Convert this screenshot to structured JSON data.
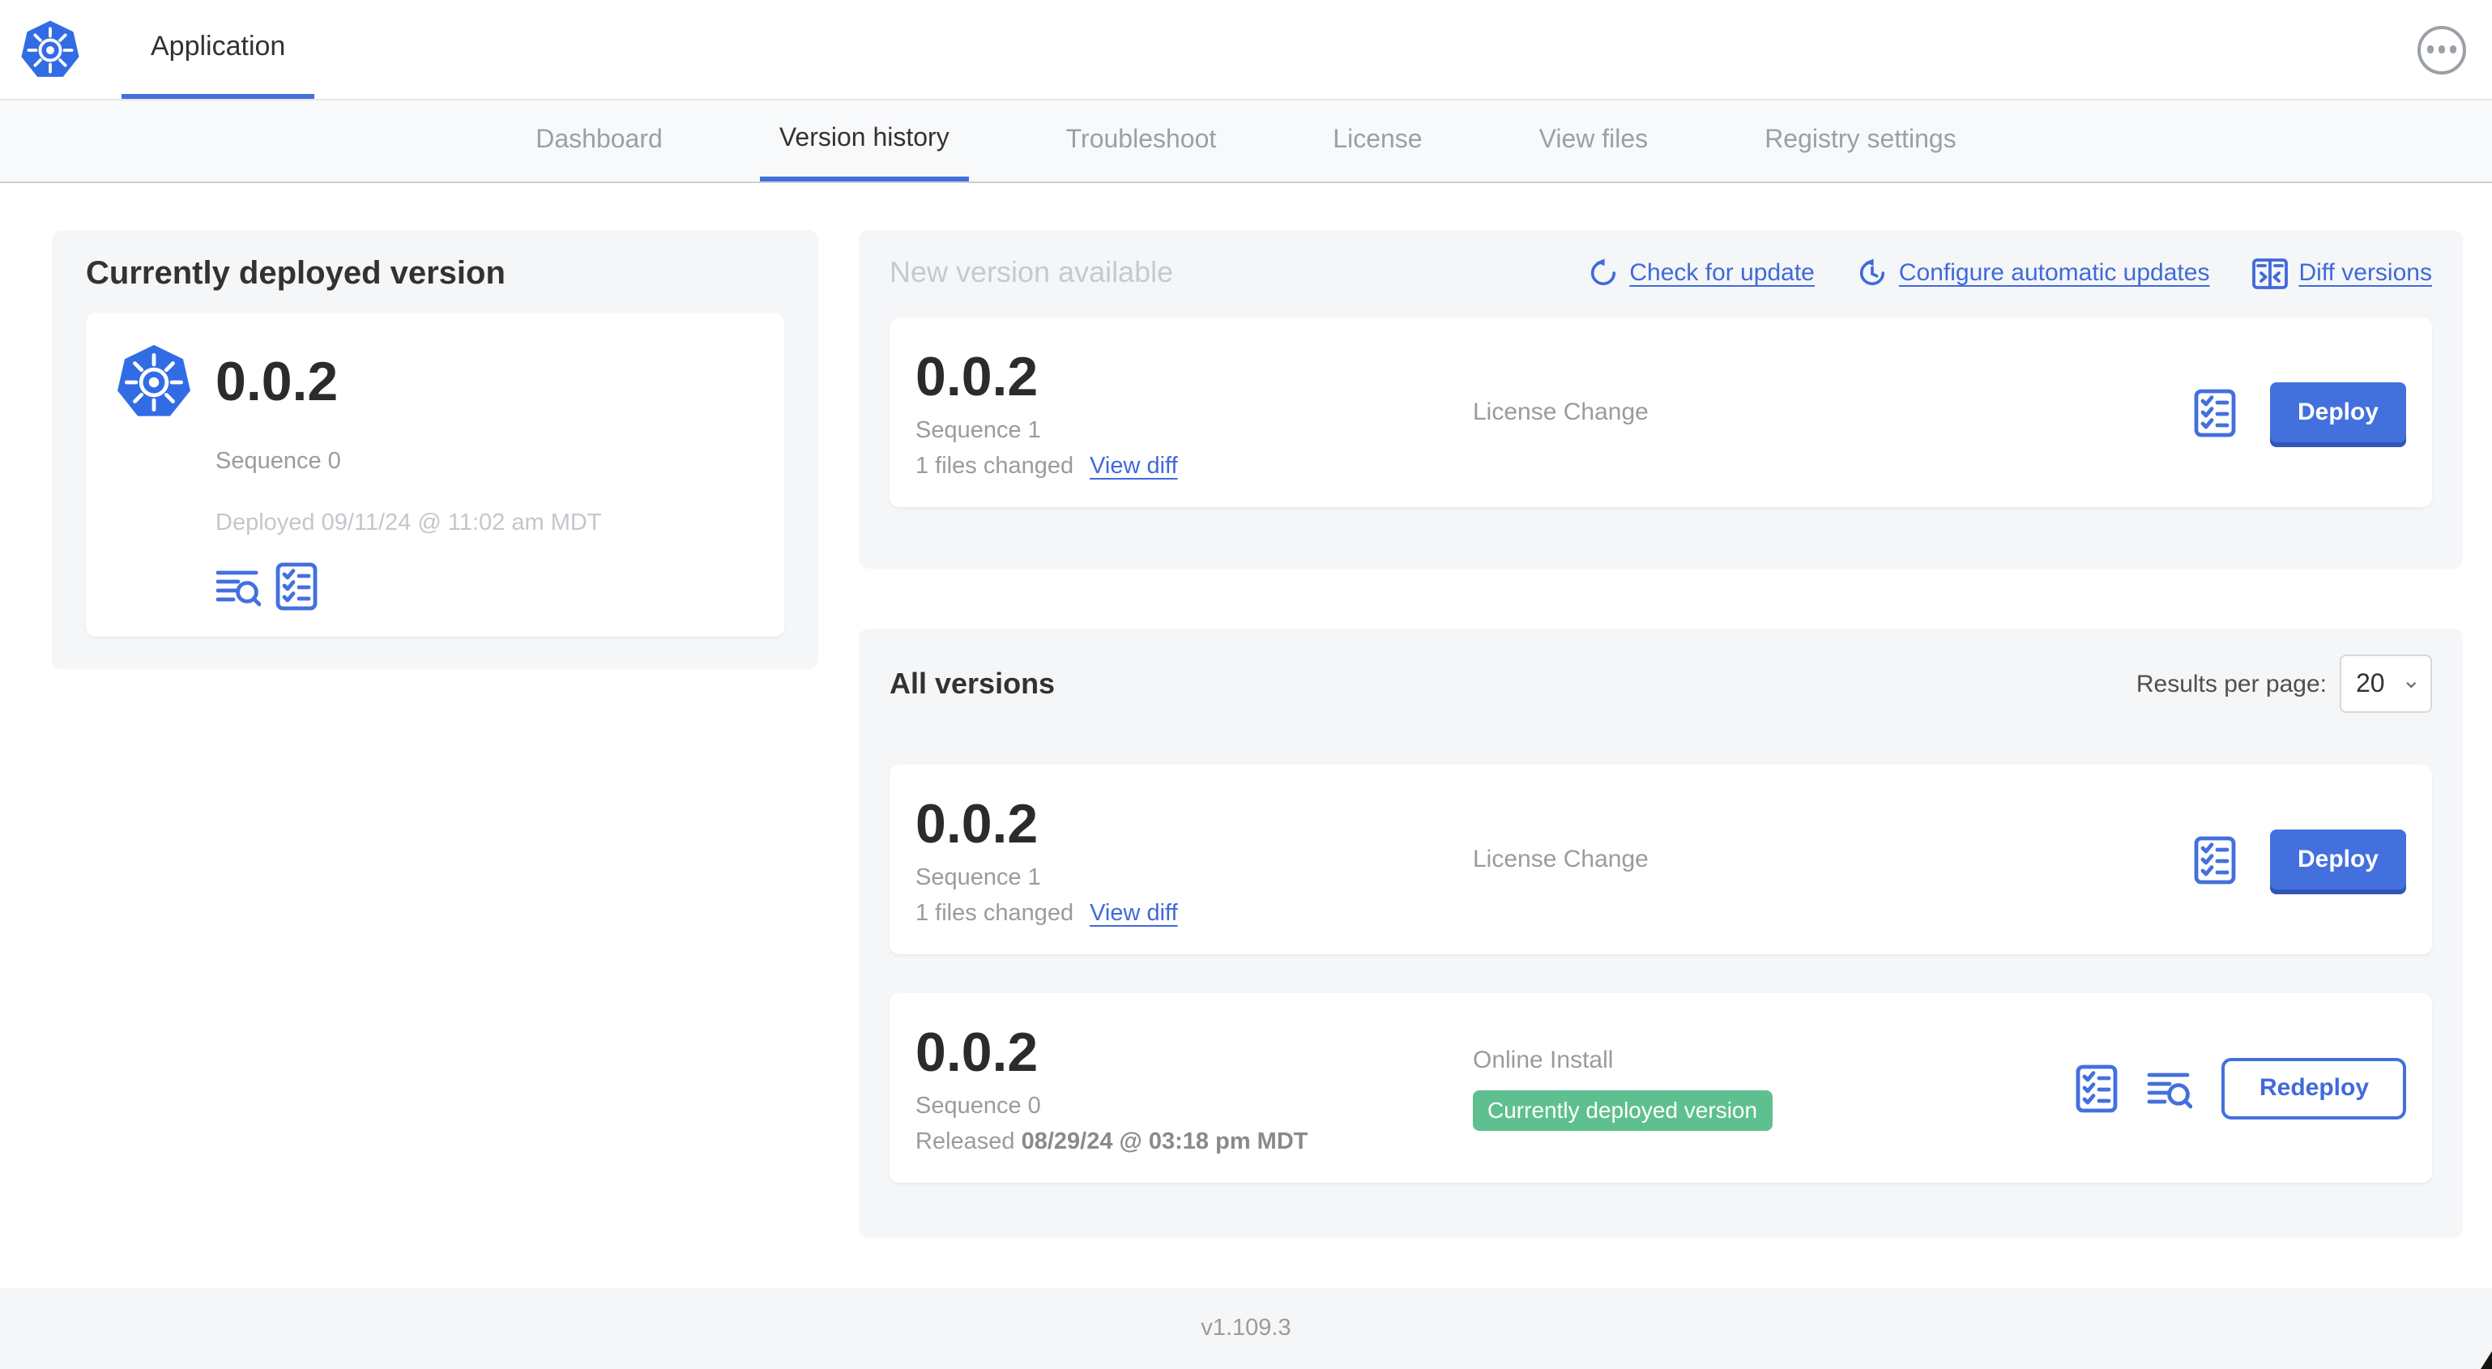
{
  "header": {
    "title": "Application"
  },
  "nav": {
    "tabs": [
      {
        "label": "Dashboard",
        "active": false
      },
      {
        "label": "Version history",
        "active": true
      },
      {
        "label": "Troubleshoot",
        "active": false
      },
      {
        "label": "License",
        "active": false
      },
      {
        "label": "View files",
        "active": false
      },
      {
        "label": "Registry settings",
        "active": false
      }
    ]
  },
  "deployed": {
    "title": "Currently deployed version",
    "version": "0.0.2",
    "sequence": "Sequence 0",
    "deployed_at": "Deployed 09/11/24 @ 11:02 am MDT"
  },
  "new_version": {
    "title": "New version available",
    "actions": [
      {
        "label": "Check for update",
        "icon": "refresh-icon"
      },
      {
        "label": "Configure automatic updates",
        "icon": "clock-refresh-icon"
      },
      {
        "label": "Diff versions",
        "icon": "diff-icon"
      }
    ],
    "card": {
      "version": "0.0.2",
      "sequence": "Sequence 1",
      "files_changed": "1 files changed",
      "view_diff": "View diff",
      "change_type": "License Change",
      "action": "Deploy"
    }
  },
  "all_versions": {
    "title": "All versions",
    "per_page_label": "Results per page:",
    "per_page_value": "20",
    "rows": [
      {
        "version": "0.0.2",
        "sequence": "Sequence 1",
        "files_changed": "1 files changed",
        "view_diff": "View diff",
        "change_type": "License Change",
        "action": "Deploy"
      },
      {
        "version": "0.0.2",
        "sequence": "Sequence 0",
        "released_prefix": "Released ",
        "released_date": "08/29/24 @ 03:18 pm MDT",
        "install_type": "Online Install",
        "badge": "Currently deployed version",
        "action": "Redeploy"
      }
    ]
  },
  "footer": {
    "version": "v1.109.3"
  },
  "colors": {
    "primary_blue": "#4370dd",
    "link_blue": "#4169db",
    "k8s_logo_blue": "#326ce5",
    "badge_green": "#5fc08f",
    "panel_gray": "#f4f6f8",
    "text_dark": "#323232",
    "text_gray": "#9b9b9b",
    "text_light_gray": "#c3c7cb"
  }
}
